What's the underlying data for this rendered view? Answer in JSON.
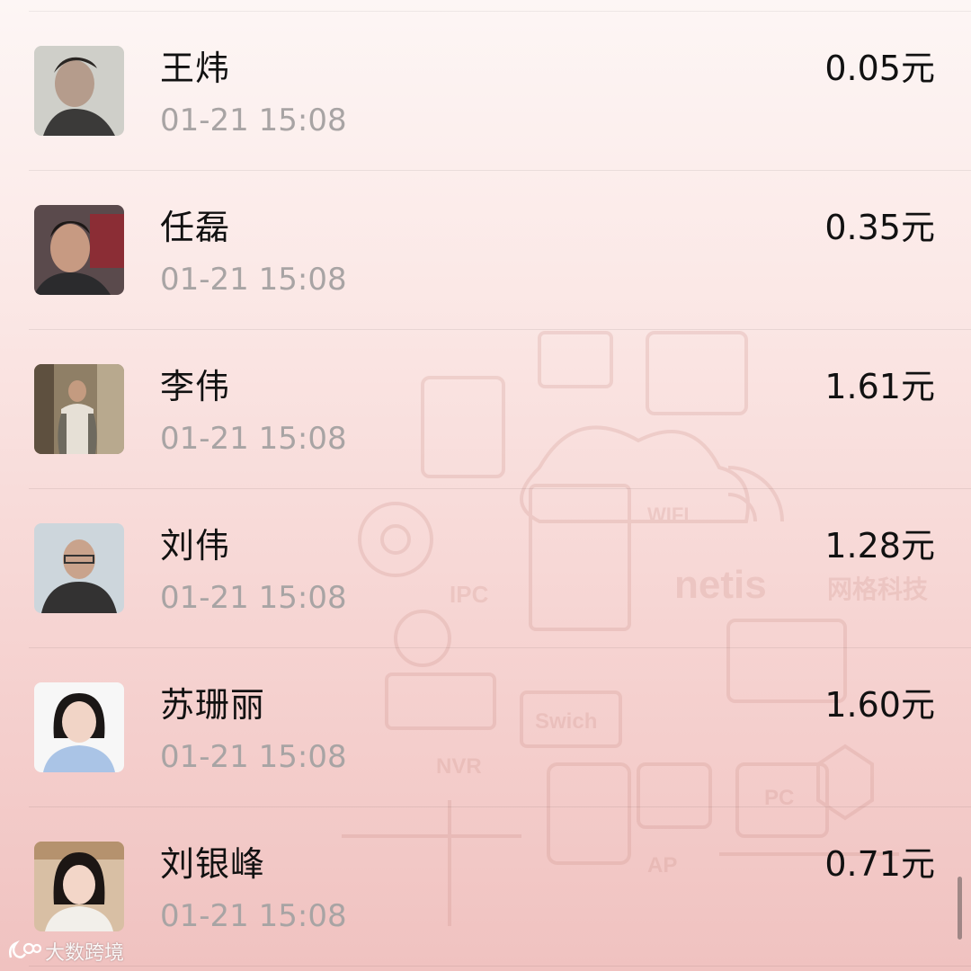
{
  "transactions": [
    {
      "name": "王炜",
      "time": "01-21 15:08",
      "amount": "0.05元"
    },
    {
      "name": "任磊",
      "time": "01-21 15:08",
      "amount": "0.35元"
    },
    {
      "name": "李伟",
      "time": "01-21 15:08",
      "amount": "1.61元"
    },
    {
      "name": "刘伟",
      "time": "01-21 15:08",
      "amount": "1.28元"
    },
    {
      "name": "苏珊丽",
      "time": "01-21 15:08",
      "amount": "1.60元"
    },
    {
      "name": "刘银峰",
      "time": "01-21 15:08",
      "amount": "0.71元"
    }
  ],
  "background_art": {
    "labels": [
      "IPC",
      "WIFI",
      "netis",
      "网格科技",
      "Swich",
      "NVR",
      "AP",
      "PC"
    ]
  },
  "watermark": {
    "text": "大数跨境"
  },
  "colors": {
    "background_top": "#fdf6f5",
    "background_bottom": "#f0c2c0",
    "name_text": "#111111",
    "time_text": "#a8a4a4"
  }
}
